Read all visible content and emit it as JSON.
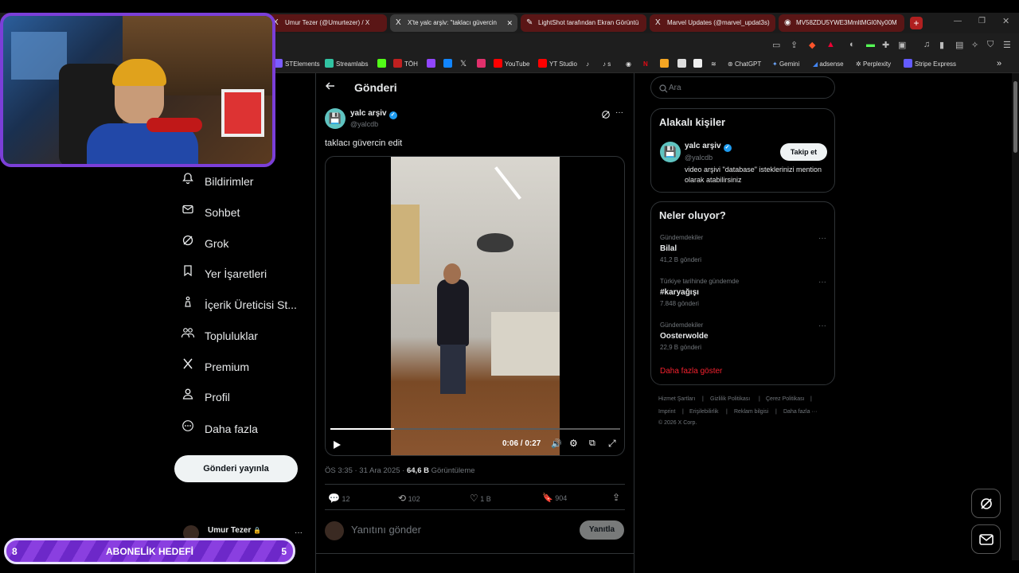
{
  "browser": {
    "tabs": [
      {
        "label": "Umur Tezer (@Umurtezer) / X",
        "icon": "X",
        "color": "#6b1a1a"
      },
      {
        "label": "X'te yalc arşiv: \"taklacı güvercin",
        "icon": "X",
        "color": "#3a3a3a"
      },
      {
        "label": "LightShot tarafından Ekran Görüntü",
        "icon": "✎",
        "color": "#6b1a1a"
      },
      {
        "label": "Marvel Updates (@marvel_updat3s)",
        "icon": "X",
        "color": "#6b1a1a"
      },
      {
        "label": "MV58ZDU5YWE3MmltMGI0Ny00M",
        "icon": "◉",
        "color": "#6b1a1a"
      }
    ],
    "new_tab": "+",
    "bookmarks": [
      {
        "label": "STElements",
        "color": "#7b5cff"
      },
      {
        "label": "Streamlabs",
        "color": "#31c3a2"
      },
      {
        "label": "",
        "color": "#53fc18"
      },
      {
        "label": "TÖH",
        "color": "#c02020"
      },
      {
        "label": "",
        "color": "#9146ff"
      },
      {
        "label": "",
        "color": "#1185fe"
      },
      {
        "label": "",
        "color": "#222"
      },
      {
        "label": "",
        "color": "#e1306c"
      },
      {
        "label": "YouTube",
        "color": "#ff0000"
      },
      {
        "label": "YT Studio",
        "color": "#ff0000"
      },
      {
        "label": "",
        "color": "#222"
      },
      {
        "label": "s",
        "color": "#222"
      },
      {
        "label": "",
        "color": "#ddd"
      },
      {
        "label": "",
        "color": "#e50914"
      },
      {
        "label": "",
        "color": "#f5a623"
      },
      {
        "label": "",
        "color": "#ddd"
      },
      {
        "label": "",
        "color": "#222"
      },
      {
        "label": "ChatGPT",
        "color": "#888"
      },
      {
        "label": "Gemini",
        "color": "#6ea8ff"
      },
      {
        "label": "adsense",
        "color": "#4285f4"
      },
      {
        "label": "Perplexity",
        "color": "#20808d"
      },
      {
        "label": "Stripe Express",
        "color": "#635bff"
      }
    ],
    "more": "»"
  },
  "nav": {
    "items": [
      {
        "label": "Bildirimler",
        "icon": "bell-icon",
        "glyph": "🔔"
      },
      {
        "label": "Sohbet",
        "icon": "mail-icon",
        "glyph": "✉"
      },
      {
        "label": "Grok",
        "icon": "grok-icon",
        "glyph": "⊘"
      },
      {
        "label": "Yer İşaretleri",
        "icon": "bookmark-icon",
        "glyph": "🔖"
      },
      {
        "label": "İçerik Üreticisi St...",
        "icon": "creator-icon",
        "glyph": "⚱"
      },
      {
        "label": "Topluluklar",
        "icon": "communities-icon",
        "glyph": "👥"
      },
      {
        "label": "Premium",
        "icon": "x-logo-icon",
        "glyph": "𝕏"
      },
      {
        "label": "Profil",
        "icon": "profile-icon",
        "glyph": "👤"
      },
      {
        "label": "Daha fazla",
        "icon": "more-icon",
        "glyph": "⋯"
      }
    ],
    "post_button": "Gönderi yayınla",
    "account_name": "Umur Tezer",
    "account_more": "···"
  },
  "overlay": {
    "goal_left": "8",
    "goal_label": "ABONELİK HEDEFİ",
    "goal_right": "5"
  },
  "post": {
    "header_title": "Gönderi",
    "author_name": "yalc arşiv",
    "author_handle": "@yalcdb",
    "text": "taklacı güvercin edit",
    "video_time": "0:06 / 0:27",
    "video_progress": 0.22,
    "timestamp": "ÖS 3:35 · 31 Ara 2025 · ",
    "views_count": "64,6 B",
    "views_label": " Görüntüleme",
    "replies": "12",
    "reposts": "102",
    "likes": "1 B",
    "bookmarks": "904",
    "reply_placeholder": "Yanıtını gönder",
    "reply_button": "Yanıtla"
  },
  "sidebar": {
    "search_placeholder": "Ara",
    "related_title": "Alakalı kişiler",
    "related_name": "yalc arşiv",
    "related_handle": "@yalcdb",
    "related_bio": "video arşivi \"database\" isteklerinizi mention olarak atabilirsiniz",
    "follow_button": "Takip et",
    "trends_title": "Neler oluyor?",
    "trends": [
      {
        "meta": "Gündemdekiler",
        "name": "Bilal",
        "count": "41,2 B gönderi"
      },
      {
        "meta": "Türkiye tarihinde gündemde",
        "name": "#karyağışı",
        "count": "7.848 gönderi"
      },
      {
        "meta": "Gündemdekiler",
        "name": "Oosterwolde",
        "count": "22,9 B gönderi"
      }
    ],
    "show_more": "Daha fazla göster",
    "footer_row1": [
      "Hizmet Şartları",
      "|",
      "Gizlilik Politikası",
      "|",
      "Çerez Politikası",
      "|"
    ],
    "footer_row2": [
      "Imprint",
      "|",
      "Erişilebilirlik",
      "|",
      "Reklam bilgisi",
      "|",
      "Daha fazla ···"
    ],
    "footer_copy": "© 2026 X Corp."
  },
  "colors": {
    "accent_purple": "#7b3fd8",
    "link_red": "#f4212e",
    "verified": "#1d9bf0"
  }
}
